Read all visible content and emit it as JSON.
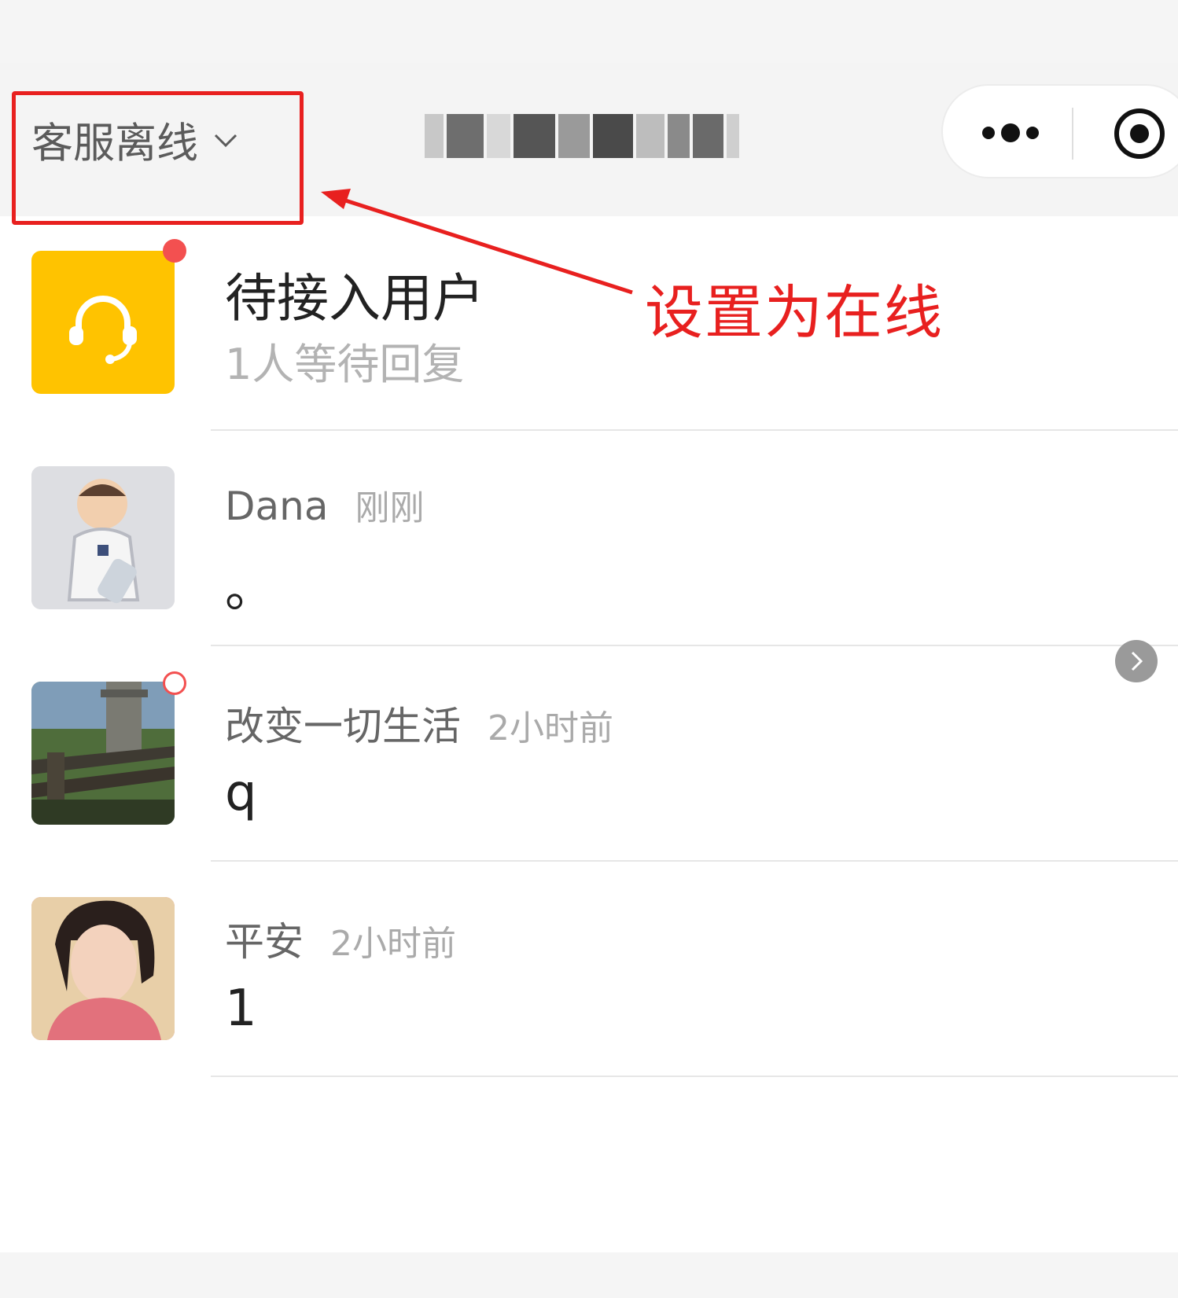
{
  "header": {
    "status_label": "客服离线",
    "status_icon": "chevron-down-icon",
    "menu_icon": "more-dots-icon",
    "close_icon": "record-close-icon"
  },
  "annotation": {
    "text": "设置为在线",
    "color": "#e8201f"
  },
  "pending": {
    "title": "待接入用户",
    "subtitle": "1人等待回复",
    "icon": "headset-icon",
    "icon_bg": "#ffc300",
    "badge_color": "#f35050"
  },
  "conversations": [
    {
      "name": "Dana",
      "time": "刚刚",
      "message": "。"
    },
    {
      "name": "改变一切生活",
      "time": "2小时前",
      "message": "q"
    },
    {
      "name": "平安",
      "time": "2小时前",
      "message": "1"
    }
  ],
  "colors": {
    "accent": "#e8201f",
    "pending_bg": "#ffc300"
  }
}
